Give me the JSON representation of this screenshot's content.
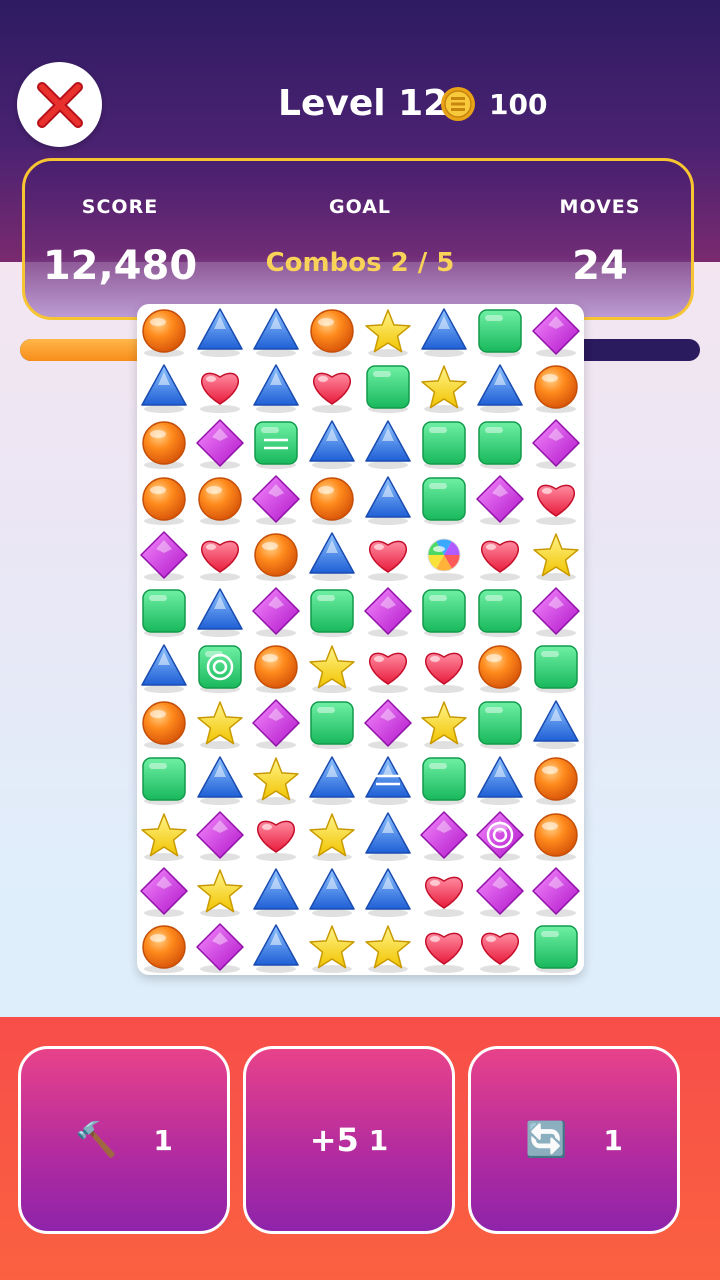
{
  "header": {
    "level_label": "Level 12",
    "coins": "100"
  },
  "stats": {
    "score_label": "SCORE",
    "score_value": "12,480",
    "goal_label": "GOAL",
    "goal_value": "Combos 2 / 5",
    "moves_label": "MOVES",
    "moves_value": "24"
  },
  "progress": {
    "fraction": 0.55
  },
  "board": {
    "columns": 8,
    "rows": 12,
    "grid": [
      [
        "orange",
        "triangle",
        "triangle",
        "orange",
        "star",
        "triangle",
        "square",
        "diamond"
      ],
      [
        "triangle",
        "heart",
        "triangle",
        "heart",
        "square",
        "star",
        "triangle",
        "orange"
      ],
      [
        "orange",
        "diamond",
        "square-striped",
        "triangle",
        "triangle",
        "square",
        "square",
        "diamond"
      ],
      [
        "orange",
        "orange",
        "diamond",
        "orange",
        "triangle",
        "square",
        "diamond",
        "heart"
      ],
      [
        "diamond",
        "heart",
        "orange",
        "triangle",
        "heart",
        "rainbow",
        "heart",
        "star"
      ],
      [
        "square",
        "triangle",
        "diamond",
        "square",
        "diamond",
        "square",
        "square",
        "diamond"
      ],
      [
        "triangle",
        "square-wrapped",
        "orange",
        "star",
        "heart",
        "heart",
        "orange",
        "square"
      ],
      [
        "orange",
        "star",
        "diamond",
        "square",
        "diamond",
        "star",
        "square",
        "triangle"
      ],
      [
        "square",
        "triangle",
        "star",
        "triangle",
        "triangle-striped",
        "square",
        "triangle",
        "orange"
      ],
      [
        "star",
        "diamond",
        "heart",
        "star",
        "triangle",
        "diamond",
        "diamond-wrapped",
        "orange"
      ],
      [
        "diamond",
        "star",
        "triangle",
        "triangle",
        "triangle",
        "heart",
        "diamond",
        "diamond"
      ],
      [
        "orange",
        "diamond",
        "triangle",
        "star",
        "star",
        "heart",
        "heart",
        "square"
      ]
    ]
  },
  "boosters": [
    {
      "name": "hammer",
      "icon": "🔨",
      "count": "1"
    },
    {
      "name": "extra-moves",
      "label": "+5",
      "count": "1"
    },
    {
      "name": "shuffle",
      "icon": "🔄",
      "count": "1"
    }
  ],
  "colors": {
    "gold_border": "#f7c531",
    "goal_text": "#f9d25a",
    "progress_fill": "#f78d1a"
  }
}
